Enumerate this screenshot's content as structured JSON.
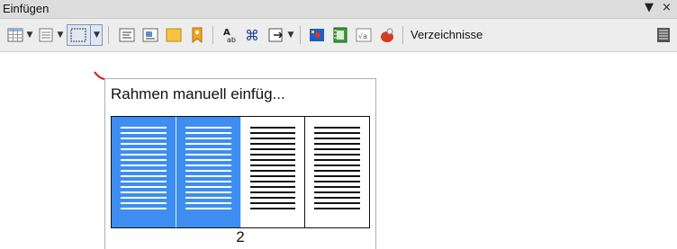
{
  "toolbar_window": {
    "title": "Einfügen",
    "menu_glyph": "▼",
    "close_glyph": "×"
  },
  "toolbar": {
    "verzeichnisse_label": "Verzeichnisse",
    "icons": [
      "table-icon",
      "section-icon",
      "frame-icon",
      "text-box-icon",
      "footnote-icon",
      "note-icon",
      "bookmark-icon",
      "special-character-icon",
      "field-icon",
      "cross-reference-icon",
      "image-icon",
      "media-icon",
      "formula-icon",
      "object-icon",
      "index-icon"
    ]
  },
  "popup": {
    "title": "Rahmen manuell einfüg...",
    "selected_columns": 2,
    "total_columns": 4,
    "count_label": "2"
  },
  "colors": {
    "selection": "#3d8ef0",
    "toolbar_bg": "#ededed",
    "titlebar_bg": "#dcdcdc"
  }
}
